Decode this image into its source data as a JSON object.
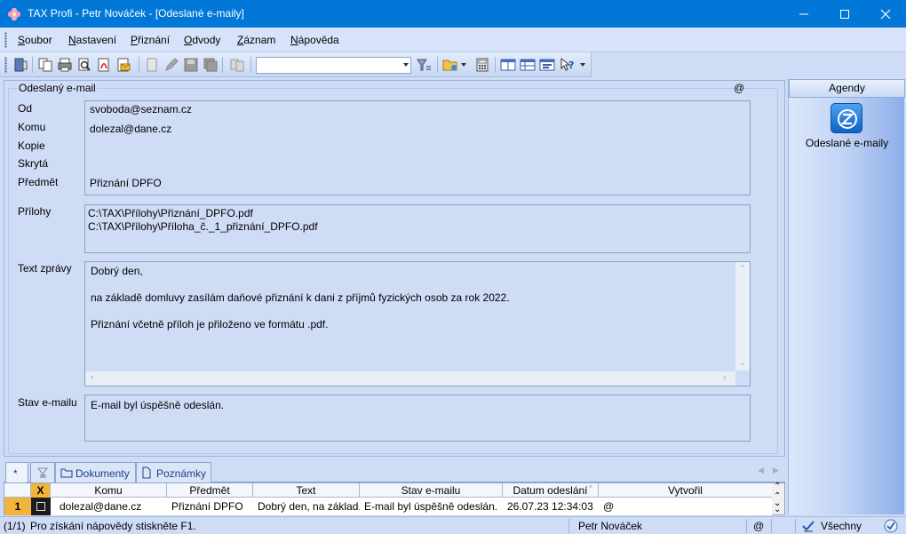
{
  "window": {
    "title": "TAX Profi - Petr Nováček - [Odeslané e-maily]"
  },
  "menu": {
    "items": [
      {
        "label_u": "S",
        "label_rest": "oubor"
      },
      {
        "label_u": "N",
        "label_rest": "astavení"
      },
      {
        "label_u": "P",
        "label_rest": "řiznání"
      },
      {
        "label_u": "O",
        "label_rest": "dvody"
      },
      {
        "label_u": "Z",
        "label_rest": "áznam"
      },
      {
        "label_u": "N",
        "label_rest": "ápověda"
      }
    ]
  },
  "toolbar": {
    "combo_value": ""
  },
  "email": {
    "group_title": "Odeslaný e-mail",
    "at_symbol": "@",
    "labels": {
      "from": "Od",
      "to": "Komu",
      "cc": "Kopie",
      "bcc": "Skrytá",
      "subject": "Předmět",
      "attachments": "Přílohy",
      "body": "Text zprávy",
      "status": "Stav e-mailu"
    },
    "from": "svoboda@seznam.cz",
    "to": "dolezal@dane.cz",
    "cc": "",
    "bcc": "",
    "subject": "Přiznání DPFO",
    "attachments": [
      "C:\\TAX\\Přílohy\\Přiznání_DPFO.pdf",
      "C:\\TAX\\Přílohy\\Příloha_č._1_přiznání_DPFO.pdf"
    ],
    "body_lines": [
      "Dobrý den,",
      "na základě domluvy zasílám daňové přiznání k dani z příjmů fyzických osob za rok 2022.",
      "Přiznání včetně příloh je přiloženo ve formátu .pdf."
    ],
    "status": "E-mail byl úspěšně odeslán."
  },
  "agendy": {
    "header": "Agendy",
    "item_label": "Odeslané e-maily"
  },
  "tabs": {
    "star": "*",
    "documents": "Dokumenty",
    "notes": "Poznámky"
  },
  "grid": {
    "headers": {
      "x": "X",
      "to": "Komu",
      "subject": "Předmět",
      "text": "Text",
      "status": "Stav e-mailu",
      "date": "Datum odeslání",
      "created": "Vytvořil"
    },
    "row": {
      "num": "1",
      "to": "dolezal@dane.cz",
      "subject": "Přiznání DPFO",
      "text": "Dobrý den, na základ...",
      "status": "E-mail byl úspěšně odeslán.",
      "date": "26.07.23 12:34:03",
      "created": "@"
    }
  },
  "statusbar": {
    "records": "(1/1)",
    "help": "Pro získání nápovědy stiskněte F1.",
    "user": "Petr Nováček",
    "at": "@",
    "filter": "Všechny"
  }
}
